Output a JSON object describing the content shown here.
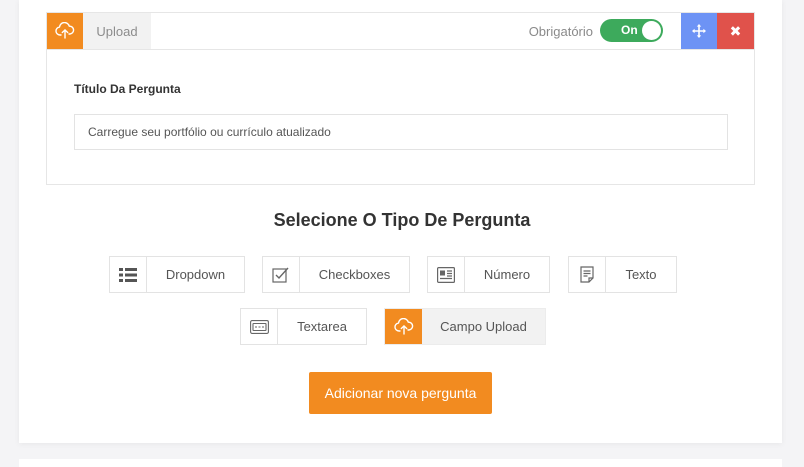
{
  "question": {
    "type_label": "Upload",
    "required_label": "Obrigatório",
    "toggle_text": "On",
    "title_label": "Título Da Pergunta",
    "title_value": "Carregue seu portfólio ou currículo atualizado",
    "delete_glyph": "✖"
  },
  "selector": {
    "title": "Selecione O Tipo De Pergunta",
    "options": [
      {
        "label": "Dropdown",
        "icon": "list-icon"
      },
      {
        "label": "Checkboxes",
        "icon": "checkbox-icon"
      },
      {
        "label": "Número",
        "icon": "number-icon"
      },
      {
        "label": "Texto",
        "icon": "document-icon"
      },
      {
        "label": "Textarea",
        "icon": "textarea-icon"
      },
      {
        "label": "Campo Upload",
        "icon": "cloud-upload-icon",
        "selected": true
      }
    ]
  },
  "add_button": "Adicionar nova pergunta",
  "colors": {
    "accent": "#f28b20",
    "toggle_on": "#3daa5c",
    "move": "#6d93f5",
    "delete": "#e0524b"
  }
}
